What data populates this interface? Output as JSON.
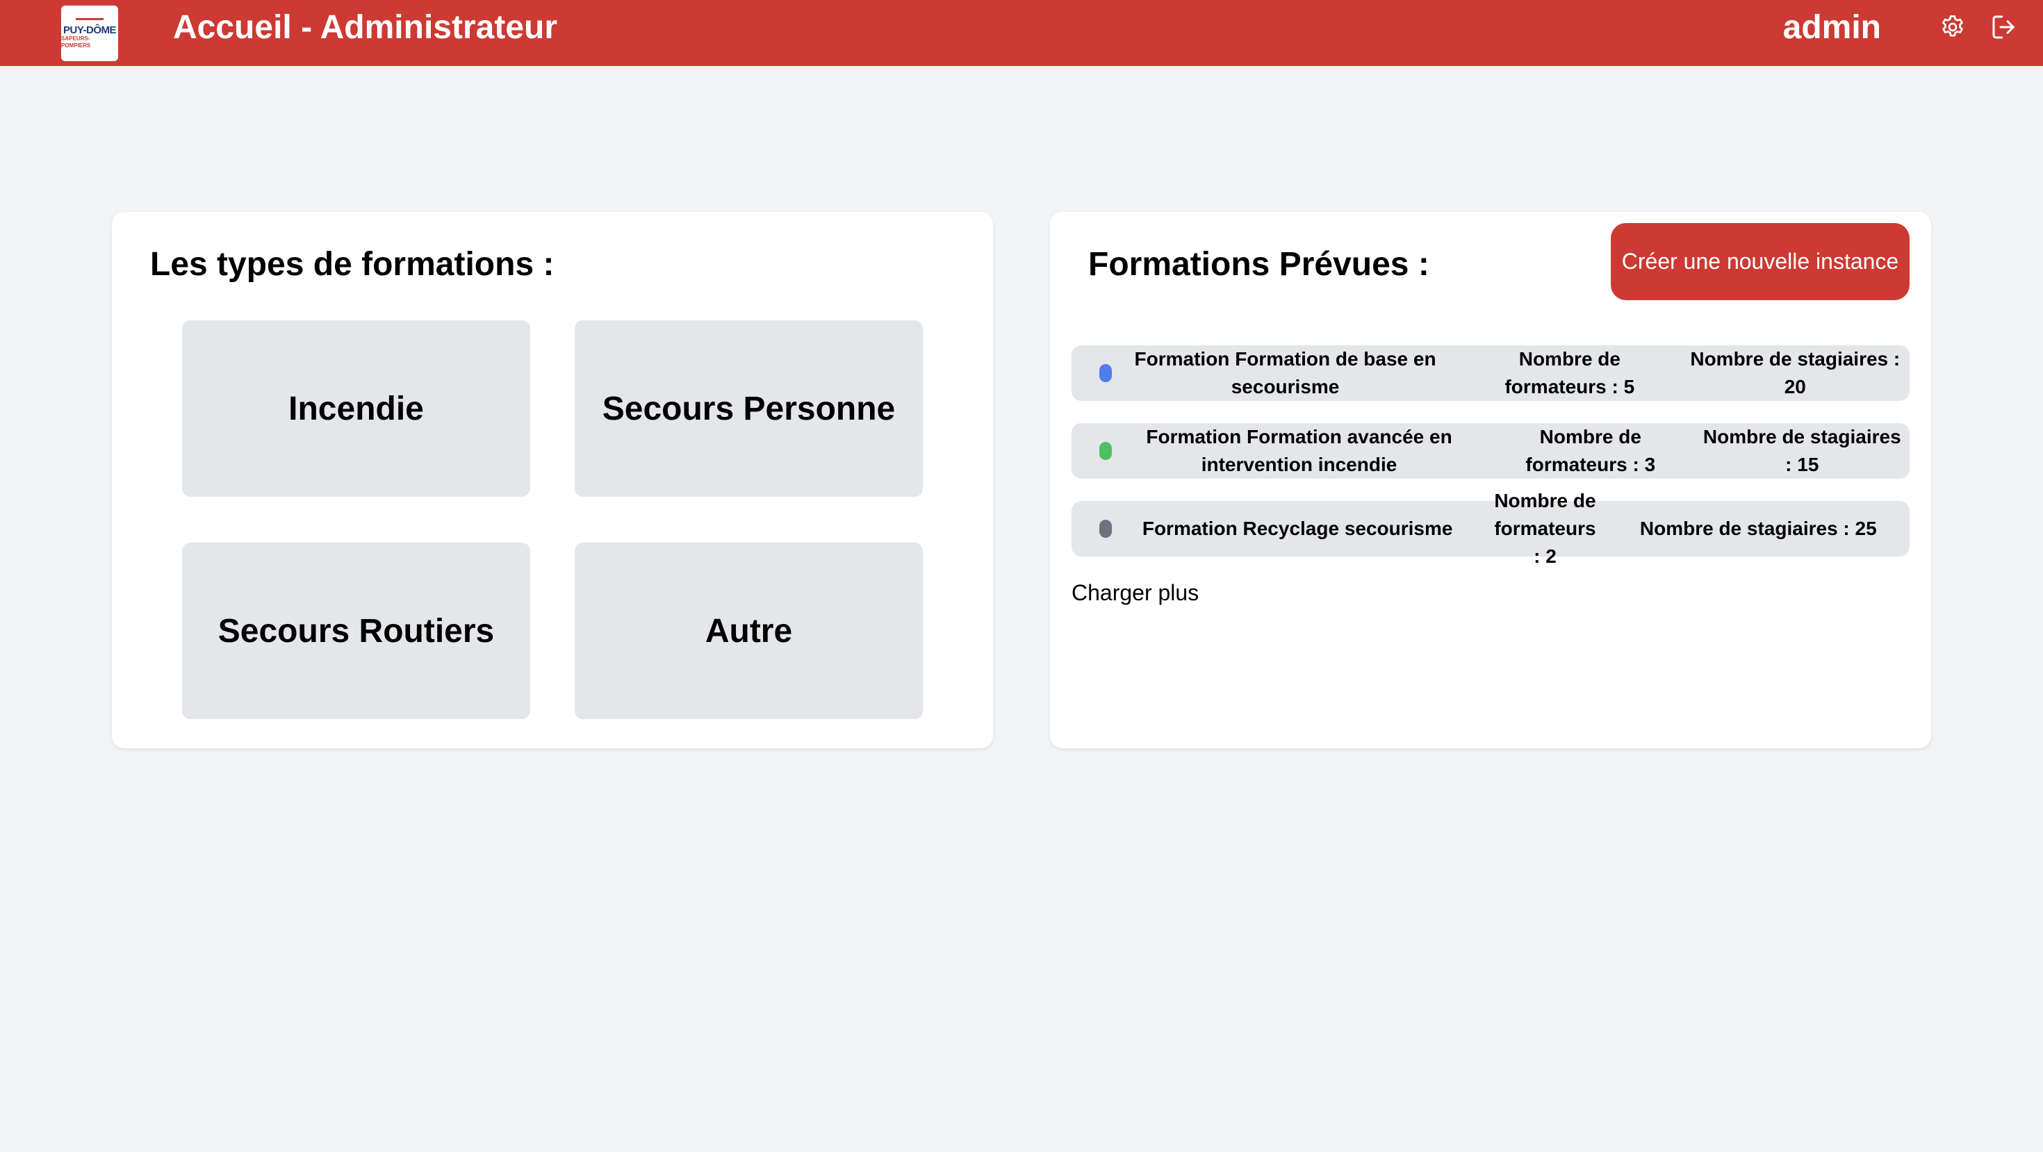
{
  "header": {
    "logo": {
      "line1": "PUY-DÔME",
      "line2": "SAPEURS-POMPIERS"
    },
    "title": "Accueil - Administrateur",
    "user": "admin",
    "icons": [
      "gear-icon",
      "logout-icon"
    ],
    "bg_color": "#cc3a33"
  },
  "types_panel": {
    "title": "Les types de formations :",
    "types": [
      "Incendie",
      "Secours Personne",
      "Secours Routiers",
      "Autre"
    ]
  },
  "planned_panel": {
    "title": "Formations Prévues :",
    "create_button": "Créer une nouvelle instance",
    "sessions": [
      {
        "name": "Formation Formation de base en secourisme",
        "trainers": "Nombre de formateurs : 5",
        "trainees": "Nombre de stagiaires : 20",
        "color": "#4f7ded"
      },
      {
        "name": "Formation Formation avancée en intervention incendie",
        "trainers": "Nombre de formateurs : 3",
        "trainees": "Nombre de stagiaires : 15",
        "color": "#4cc063"
      },
      {
        "name": "Formation Recyclage secourisme",
        "trainers": "Nombre de formateurs : 2",
        "trainees": "Nombre de stagiaires : 25",
        "color": "#6b7280"
      }
    ],
    "load_more": "Charger plus"
  }
}
